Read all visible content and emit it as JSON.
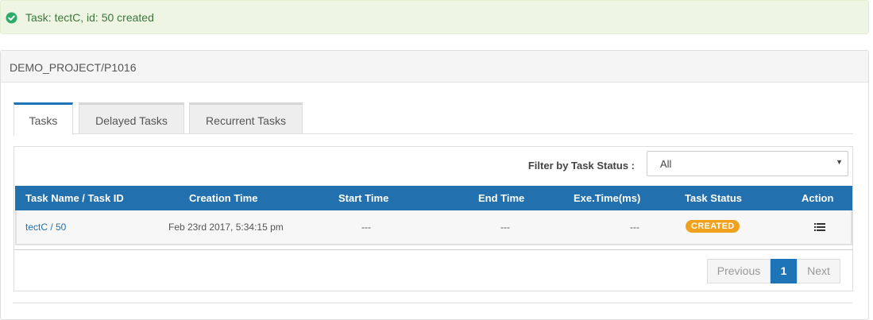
{
  "alert": {
    "icon": "check-circle-icon",
    "message": "Task: tectC, id: 50 created",
    "color": "#3c763d"
  },
  "panel": {
    "title": "DEMO_PROJECT/P1016"
  },
  "tabs": [
    {
      "label": "Tasks",
      "active": true
    },
    {
      "label": "Delayed Tasks",
      "active": false
    },
    {
      "label": "Recurrent Tasks",
      "active": false
    }
  ],
  "filter": {
    "label": "Filter by Task Status :",
    "value": "All"
  },
  "table": {
    "header_color": "#2270ad",
    "columns": [
      "Task Name / Task ID",
      "Creation Time",
      "Start Time",
      "End Time",
      "Exe.Time(ms)",
      "Task Status",
      "Action"
    ],
    "rows": [
      {
        "task": "tectC / 50",
        "creation_time": "Feb 23rd 2017, 5:34:15 pm",
        "start_time": "---",
        "end_time": "---",
        "exe_time": "---",
        "status": "CREATED",
        "status_color": "#f0a21e",
        "action_icon": "list-icon"
      }
    ]
  },
  "pagination": {
    "previous": "Previous",
    "current": "1",
    "next": "Next"
  }
}
